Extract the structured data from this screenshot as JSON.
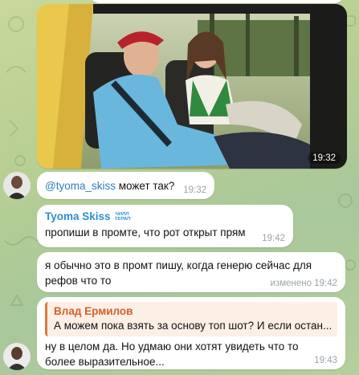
{
  "photo_message": {
    "time": "19:32"
  },
  "msg1": {
    "mention": "@tyoma_skiss",
    "text": " может так?",
    "time": "19:32"
  },
  "msg2": {
    "sender": "Tyoma Skiss",
    "badge_line1": "ЧИЛЛ",
    "badge_line2": "ТЕРАП",
    "text": "пропиши в промте, что рот открыт прям",
    "time": "19:42"
  },
  "msg3": {
    "text": "я обычно это в промт пишу, когда генерю сейчас для рефов что то",
    "time": "изменено 19:42"
  },
  "msg4": {
    "reply_sender": "Влад Ермилов",
    "reply_text": "А можем пока взять за основу топ шот? И если остан...",
    "text": "ну в целом да. Но удмаю они хотят увидеть что то более выразительное...",
    "time": "19:43"
  },
  "colors": {
    "accent": "#2e8fd0",
    "reply_bar": "#e07a3a",
    "reply_name": "#d4612a",
    "reply_bg": "#fbefe6"
  }
}
